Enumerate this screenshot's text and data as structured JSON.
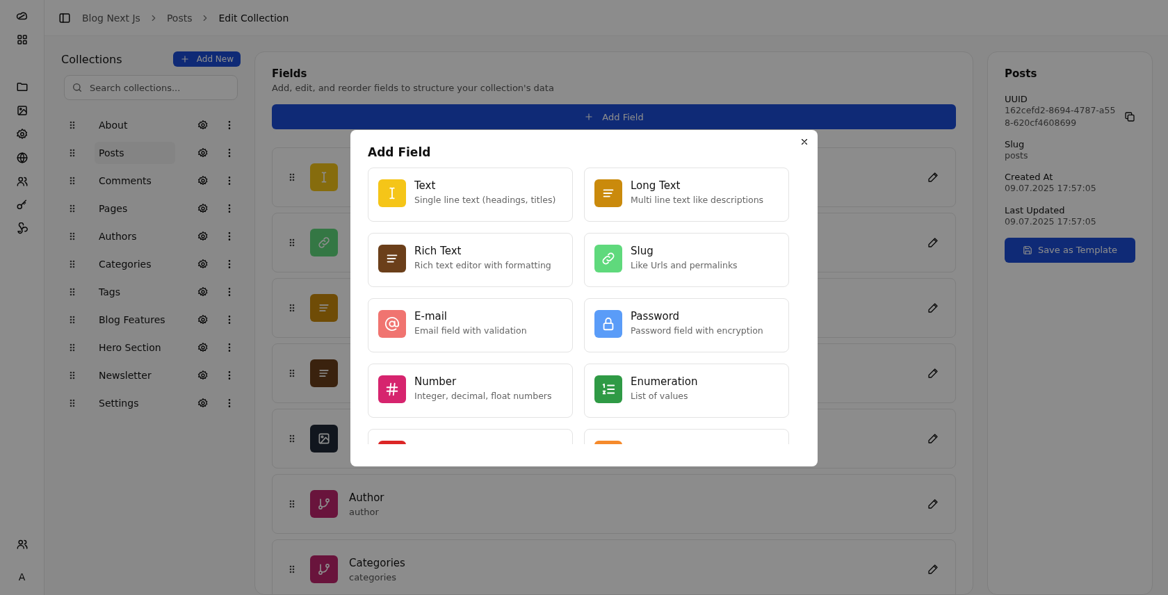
{
  "rail": {
    "avatar": "A"
  },
  "breadcrumb": [
    "Blog Next Js",
    "Posts",
    "Edit Collection"
  ],
  "collections": {
    "title": "Collections",
    "add_button": "Add New",
    "search": {
      "placeholder": "Search collections..."
    },
    "items": [
      {
        "label": "About",
        "selected": false
      },
      {
        "label": "Posts",
        "selected": true
      },
      {
        "label": "Comments",
        "selected": false
      },
      {
        "label": "Pages",
        "selected": false
      },
      {
        "label": "Authors",
        "selected": false
      },
      {
        "label": "Categories",
        "selected": false
      },
      {
        "label": "Tags",
        "selected": false
      },
      {
        "label": "Blog Features",
        "selected": false
      },
      {
        "label": "Hero Section",
        "selected": false
      },
      {
        "label": "Newsletter",
        "selected": false
      },
      {
        "label": "Settings",
        "selected": false
      }
    ]
  },
  "fields": {
    "title": "Fields",
    "subtitle": "Add, edit, and reorder fields to structure your collection's data",
    "add_button": "Add Field",
    "rows": [
      {
        "kind": "text"
      },
      {
        "kind": "slug"
      },
      {
        "kind": "longtext"
      },
      {
        "kind": "richtext"
      },
      {
        "kind": "media"
      },
      {
        "title": "Author",
        "key": "author",
        "kind": "relation"
      },
      {
        "title": "Categories",
        "key": "categories",
        "kind": "relation"
      }
    ]
  },
  "info": {
    "title": "Posts",
    "entries": [
      {
        "label": "UUID",
        "value": "162cefd2-8694-4787-a558-620cf4608699",
        "copyable": true
      },
      {
        "label": "Slug",
        "value": "posts",
        "copyable": false
      },
      {
        "label": "Created At",
        "value": "09.07.2025 17:57:05",
        "copyable": false
      },
      {
        "label": "Last Updated",
        "value": "09.07.2025 17:57:05",
        "copyable": false
      }
    ],
    "button": "Save as Template"
  },
  "modal": {
    "title": "Add Field",
    "options": [
      {
        "title": "Text",
        "description": "Single line text (headings, titles)",
        "kind": "text"
      },
      {
        "title": "Long Text",
        "description": "Multi line text like descriptions",
        "kind": "longtext"
      },
      {
        "title": "Rich Text",
        "description": "Rich text editor with formatting",
        "kind": "richtext"
      },
      {
        "title": "Slug",
        "description": "Like Urls and permalinks",
        "kind": "slug"
      },
      {
        "title": "E-mail",
        "description": "Email field with validation",
        "kind": "email"
      },
      {
        "title": "Password",
        "description": "Password field with encryption",
        "kind": "password"
      },
      {
        "title": "Number",
        "description": "Integer, decimal, float numbers",
        "kind": "number"
      },
      {
        "title": "Enumeration",
        "description": "List of values",
        "kind": "enumeration"
      },
      {
        "kind": "boolean"
      },
      {
        "kind": "color"
      }
    ]
  }
}
